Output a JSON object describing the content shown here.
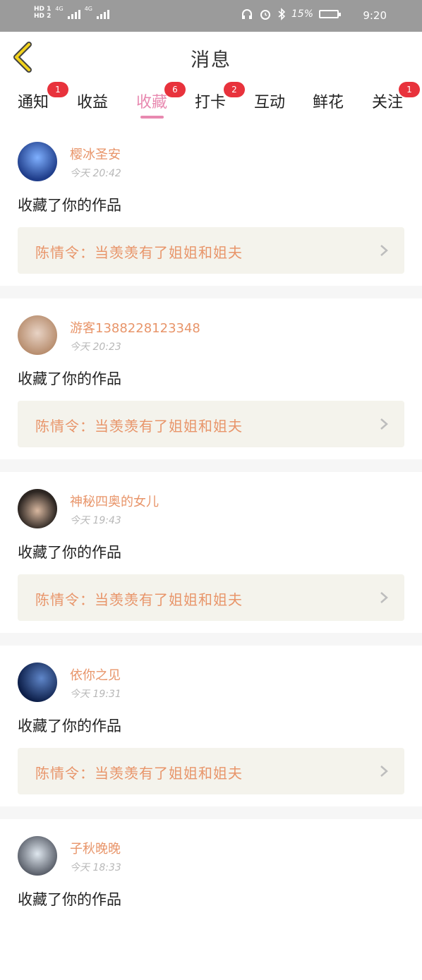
{
  "status_bar": {
    "hd1": "HD 1",
    "hd2": "HD 2",
    "net1": "4G",
    "net2": "4G",
    "battery": "15%",
    "time": "9:20"
  },
  "header": {
    "title": "消息"
  },
  "tabs": [
    {
      "label": "通知",
      "badge": "1",
      "active": false
    },
    {
      "label": "收益",
      "badge": "",
      "active": false
    },
    {
      "label": "收藏",
      "badge": "6",
      "active": true
    },
    {
      "label": "打卡",
      "badge": "2",
      "active": false
    },
    {
      "label": "互动",
      "badge": "",
      "active": false
    },
    {
      "label": "鲜花",
      "badge": "",
      "active": false
    },
    {
      "label": "关注",
      "badge": "1",
      "active": false
    }
  ],
  "notifications": [
    {
      "user": "樱冰圣安",
      "time": "今天  20:42",
      "action": "收藏了你的作品",
      "work": "陈情令：当羡羡有了姐姐和姐夫",
      "avatar_colors": [
        "#1f3d8a",
        "#7fb0ff"
      ]
    },
    {
      "user": "游客1388228123348",
      "time": "今天  20:23",
      "action": "收藏了你的作品",
      "work": "陈情令：当羡羡有了姐姐和姐夫",
      "avatar_colors": [
        "#e8d3c5",
        "#b58a6a"
      ]
    },
    {
      "user": "神秘四奥的女儿",
      "time": "今天  19:43",
      "action": "收藏了你的作品",
      "work": "陈情令：当羡羡有了姐姐和姐夫",
      "avatar_colors": [
        "#2d2622",
        "#d9b8a0"
      ]
    },
    {
      "user": "依你之见",
      "time": "今天  19:31",
      "action": "收藏了你的作品",
      "work": "陈情令：当羡羡有了姐姐和姐夫",
      "avatar_colors": [
        "#0d1f4a",
        "#5f86c9"
      ]
    },
    {
      "user": "子秋晚晚",
      "time": "今天  18:33",
      "action": "收藏了你的作品",
      "work": "",
      "avatar_colors": [
        "#dfe7ef",
        "#4a4f5a"
      ]
    }
  ],
  "colors": {
    "accent": "#e889b0",
    "badge": "#e8323c",
    "username": "#e8956a",
    "work_bg": "#f4f3ec"
  }
}
